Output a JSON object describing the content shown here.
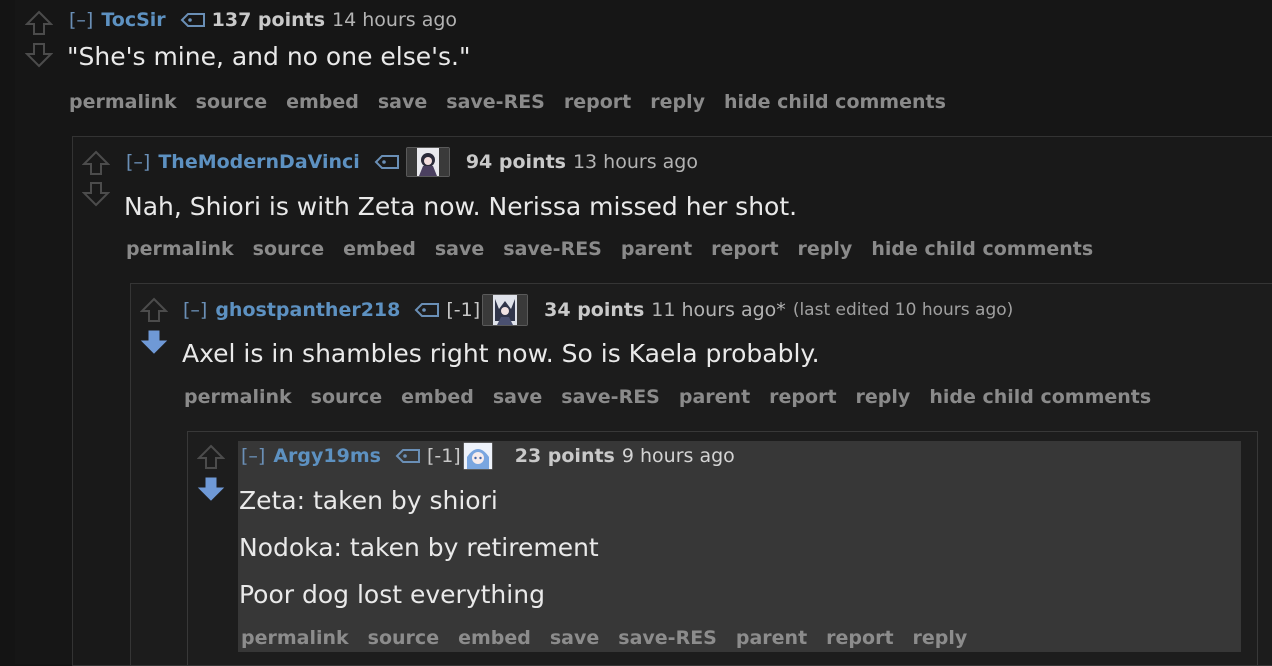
{
  "comments": [
    {
      "toggle": "[–]",
      "author": "TocSir",
      "points": "137 points",
      "time": "14 hours ago",
      "body": [
        "\"She's mine, and no one else's.\""
      ],
      "buttons": [
        "permalink",
        "source",
        "embed",
        "save",
        "save-RES",
        "report",
        "reply",
        "hide child comments"
      ],
      "vote": "none"
    },
    {
      "toggle": "[–]",
      "author": "TheModernDaVinci",
      "points": "94 points",
      "time": "13 hours ago",
      "body": [
        "Nah, Shiori is with Zeta now. Nerissa missed her shot."
      ],
      "buttons": [
        "permalink",
        "source",
        "embed",
        "save",
        "save-RES",
        "parent",
        "report",
        "reply",
        "hide child comments"
      ],
      "vote": "none"
    },
    {
      "toggle": "[–]",
      "author": "ghostpanther218",
      "flair": "[-1]",
      "points": "34 points",
      "time": "11 hours ago*",
      "edited": "(last edited 10 hours ago)",
      "body": [
        "Axel is in shambles right now. So is Kaela probably."
      ],
      "buttons": [
        "permalink",
        "source",
        "embed",
        "save",
        "save-RES",
        "parent",
        "report",
        "reply",
        "hide child comments"
      ],
      "vote": "down"
    },
    {
      "toggle": "[–]",
      "author": "Argy19ms",
      "flair": "[-1]",
      "points": "23 points",
      "time": "9 hours ago",
      "body": [
        "Zeta: taken by shiori",
        "Nodoka: taken by retirement",
        "Poor dog lost everything"
      ],
      "buttons": [
        "permalink",
        "source",
        "embed",
        "save",
        "save-RES",
        "parent",
        "report",
        "reply"
      ],
      "vote": "down"
    }
  ],
  "icons": {
    "upvote": "upvote-arrow-icon",
    "downvote": "downvote-arrow-icon",
    "tag": "user-tag-icon",
    "avatar": "flair-avatar-icon"
  },
  "colors": {
    "background": "#141414",
    "author": "#5d91c1",
    "downvoted": "#6f99d6",
    "neutral_arrow": "#4a4a4a",
    "button_text": "#8a8a8a"
  }
}
